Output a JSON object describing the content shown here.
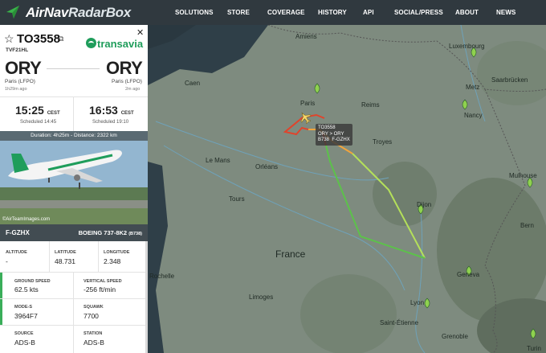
{
  "brand": {
    "name_a": "AirNav",
    "name_b": "RadarBox"
  },
  "nav": [
    "SOLUTIONS",
    "STORE",
    "COVERAGE",
    "HISTORY",
    "API",
    "SOCIAL/PRESS",
    "ABOUT",
    "NEWS"
  ],
  "flight": {
    "number": "TO3558",
    "callsign": "TVF21HL",
    "airline": "transavia",
    "origin_code": "ORY",
    "origin_name": "Paris (LFPO)",
    "origin_ago": "1h29m ago",
    "dest_code": "ORY",
    "dest_name": "Paris (LFPO)",
    "dest_ago": "2m ago",
    "dep_time": "15:25",
    "dep_tz": "CEST",
    "dep_sched": "Scheduled 14:45",
    "arr_time": "16:53",
    "arr_tz": "CEST",
    "arr_sched": "Scheduled 19:10",
    "duration": "Duration: 4h25m - Distance: 2322 km",
    "photo_credit": "©AirTeamImages.com",
    "registration": "F-GZHX",
    "aircraft": "BOEING 737-8K2",
    "aircraft_code": "(B738)"
  },
  "stats": {
    "altitude_label": "ALTITUDE",
    "altitude": "-",
    "latitude_label": "LATITUDE",
    "latitude": "48.731",
    "longitude_label": "LONGITUDE",
    "longitude": "2.348",
    "gs_label": "GROUND SPEED",
    "gs": "62.5 kts",
    "vs_label": "VERTICAL SPEED",
    "vs": "-256 ft/min",
    "modes_label": "MODE-S",
    "modes": "3964F7",
    "squawk_label": "SQUAWK",
    "squawk": "7700",
    "source_label": "SOURCE",
    "source": "ADS-B",
    "station_label": "STATION",
    "station": "ADS-B"
  },
  "map": {
    "tag_flight": "TO3558",
    "tag_route": "ORY > ORY",
    "tag_type": "B738",
    "tag_reg": "F-GZHX",
    "cities": {
      "amiens": "Amiens",
      "caen": "Caen",
      "paris": "Paris",
      "reims": "Reims",
      "troyes": "Troyes",
      "lemans": "Le Mans",
      "orleans": "Orléans",
      "tours": "Tours",
      "dijon": "Dijon",
      "nancy": "Nancy",
      "metz": "Metz",
      "luxembourg": "Luxembourg",
      "saarbrucken": "Saarbrücken",
      "mulhouse": "Mulhouse",
      "bern": "Bern",
      "rochelle": "Rochelle",
      "limoges": "Limoges",
      "lyon": "Lyon",
      "geneva": "Geneva",
      "saint_etienne": "Saint-Étienne",
      "grenoble": "Grenoble",
      "turin": "Turin",
      "france": "France"
    }
  },
  "colors": {
    "brand_green": "#1f9d5b",
    "track_red": "#e0442c",
    "track_orange": "#f2a43c",
    "track_green": "#8fd14f",
    "accent": "#3aae5a"
  }
}
